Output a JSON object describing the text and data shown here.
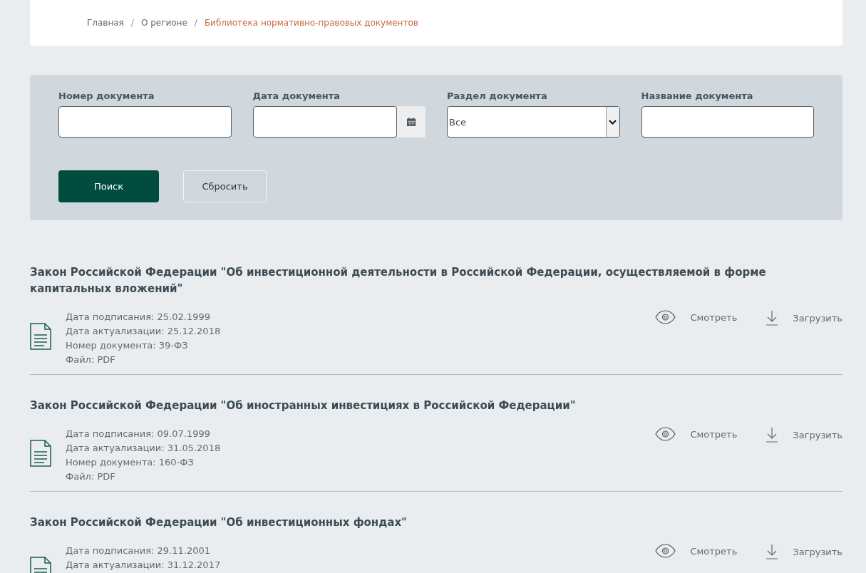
{
  "breadcrumbs": [
    {
      "label": "Главная",
      "selected": false
    },
    {
      "label": "О регионе",
      "selected": false
    },
    {
      "label": "Библиотека нормативно-правовых документов",
      "selected": true
    }
  ],
  "breadcrumb_separator": "/",
  "filters": {
    "fields": [
      {
        "kind": "text",
        "label": "Номер документа"
      },
      {
        "kind": "date",
        "label": "Дата документа"
      },
      {
        "kind": "select",
        "label": "Раздел документа",
        "value": "Все"
      },
      {
        "kind": "text",
        "label": "Название документа"
      }
    ],
    "buttons": [
      {
        "kind": "primary",
        "label": "Поиск"
      },
      {
        "kind": "secondary",
        "label": "Сбросить"
      }
    ]
  },
  "documents": [
    {
      "title": "Закон Российской Федерации \"Об инвестиционной деятельности в Российской Федерации, осуществляемой в форме капитальных вложений\"",
      "meta": [
        "Дата подписания: 25.02.1999",
        "Дата актуализации: 25.12.2018",
        "Номер документа: 39-ФЗ",
        "Файл: PDF"
      ],
      "view": "Смотреть",
      "download": "Загрузить"
    },
    {
      "title": "Закон Российской Федерации \"Об иностранных инвестициях в Российской Федерации\"",
      "meta": [
        "Дата подписания: 09.07.1999",
        "Дата актуализации: 31.05.2018",
        "Номер документа: 160-ФЗ",
        "Файл: PDF"
      ],
      "view": "Смотреть",
      "download": "Загрузить"
    },
    {
      "title": "Закон Российской Федерации \"Об инвестиционных фондах\"",
      "meta": [
        "Дата подписания: 29.11.2001",
        "Дата актуализации: 31.12.2017"
      ],
      "view": "Смотреть",
      "download": "Загрузить"
    }
  ]
}
